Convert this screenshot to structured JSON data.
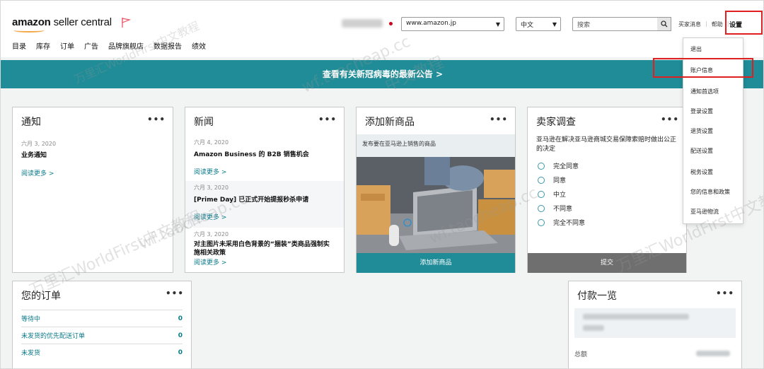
{
  "header": {
    "logo_brand": "amazon",
    "logo_product": " seller central",
    "marketplace": "www.amazon.jp",
    "language": "中文",
    "search_placeholder": "搜索",
    "top_links": [
      "买家消息",
      "帮助"
    ],
    "settings_label": "设置"
  },
  "nav": {
    "items": [
      "目录",
      "库存",
      "订单",
      "广告",
      "品牌旗舰店",
      "数据报告",
      "绩效"
    ]
  },
  "banner": {
    "text": "查看有关新冠病毒的最新公告 >"
  },
  "notice": {
    "title": "通知",
    "menu": "•••",
    "date": "六月 3, 2020",
    "headline": "业务通知",
    "read_more": "阅读更多 >"
  },
  "news": {
    "title": "新闻",
    "menu": "•••",
    "items": [
      {
        "date": "六月 4, 2020",
        "headline": "Amazon Business 的 B2B 销售机会",
        "read_more": "阅读更多 >"
      },
      {
        "date": "六月 3, 2020",
        "headline": "[Prime Day] 已正式开始提报秒杀申请",
        "read_more": "阅读更多 >"
      },
      {
        "date": "六月 3, 2020",
        "headline": "对主图片未采用白色背景的“捆装”类商品强制实施相关政策",
        "read_more": "阅读更多 >"
      }
    ]
  },
  "add_product": {
    "title": "添加新商品",
    "menu": "•••",
    "description": "发布要在亚马逊上销售的商品",
    "button": "添加新商品"
  },
  "survey": {
    "title": "卖家调查",
    "menu": "•••",
    "question": "亚马逊在解决亚马逊商城交易保障索赔时做出公正的决定",
    "options": [
      "完全同意",
      "同意",
      "中立",
      "不同意",
      "完全不同意"
    ],
    "submit": "提交"
  },
  "orders": {
    "title": "您的订单",
    "menu": "•••",
    "rows": [
      {
        "label": "等待中",
        "count": "0"
      },
      {
        "label": "未发货的优先配送订单",
        "count": "0"
      },
      {
        "label": "未发货",
        "count": "0"
      }
    ]
  },
  "payments": {
    "title": "付款一览",
    "menu": "•••",
    "row_label": "总额"
  },
  "settings_menu": {
    "items": [
      "退出",
      "账户信息",
      "通知首选项",
      "登录设置",
      "退货设置",
      "配送设置",
      "税务设置",
      "您的信息和政策",
      "亚马逊物流"
    ]
  },
  "watermarks": [
    "万里汇WorldFirst中文教程",
    "wf.taocheap.cc",
    "中文教程",
    "万里汇WorldFirst中文教程",
    "wf.taocheap.cc",
    "万里汇WorldFirst中文教程",
    "wf.taocheap.cc"
  ],
  "colors": {
    "teal": "#1f8c97",
    "link": "#0a7a8a",
    "highlight_red": "#e02020",
    "submit_gray": "#6f6f6f"
  }
}
